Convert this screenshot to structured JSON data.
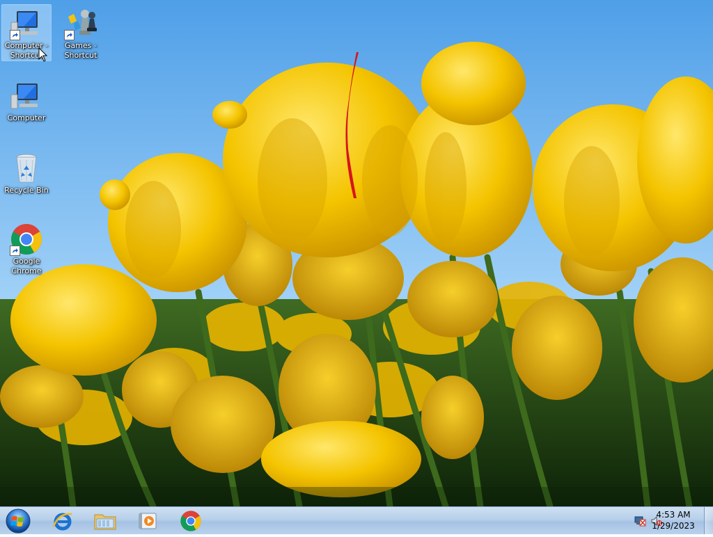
{
  "desktop": {
    "icons": [
      {
        "label": "Computer - Shortcut",
        "icon": "computer-icon",
        "shortcut": true,
        "selected": true
      },
      {
        "label": "Games - Shortcut",
        "icon": "games-icon",
        "shortcut": true,
        "selected": false
      },
      {
        "label": "Computer",
        "icon": "computer-icon",
        "shortcut": false,
        "selected": false
      },
      {
        "label": "Recycle Bin",
        "icon": "recycle-bin-icon",
        "shortcut": false,
        "selected": false
      },
      {
        "label": "Google Chrome",
        "icon": "chrome-icon",
        "shortcut": true,
        "selected": false
      }
    ]
  },
  "taskbar": {
    "pinned": [
      {
        "icon": "internet-explorer-icon"
      },
      {
        "icon": "windows-explorer-icon"
      },
      {
        "icon": "media-player-icon"
      },
      {
        "icon": "chrome-icon"
      }
    ],
    "tray": {
      "icons": [
        "network-icon",
        "volume-muted-icon"
      ],
      "time": "4:53 AM",
      "date": "1/29/2023"
    }
  },
  "colors": {
    "sky": "#6cb2ec",
    "tulip": "#f2c200",
    "taskbar": "#b7cfea"
  }
}
